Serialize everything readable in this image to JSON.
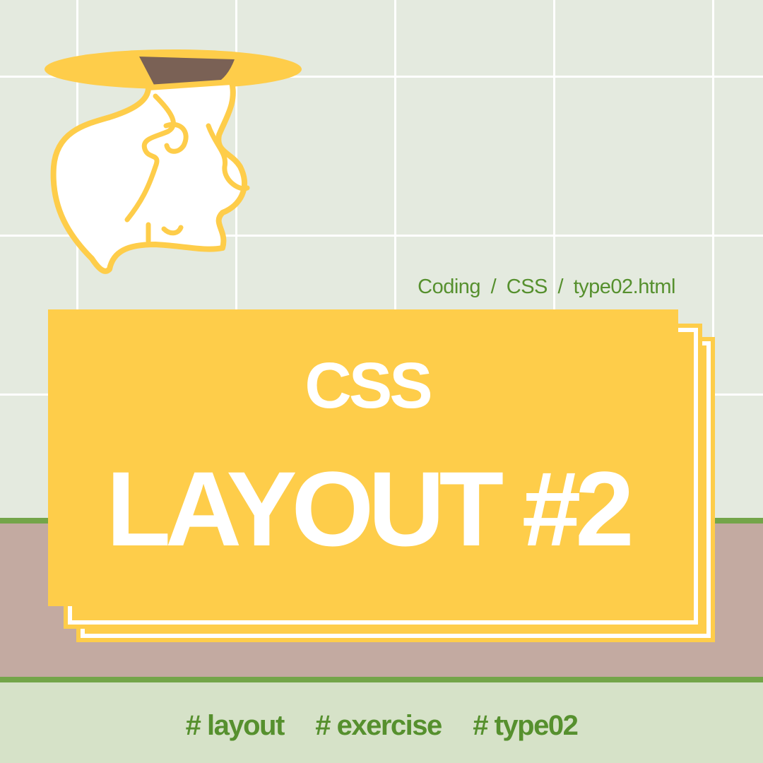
{
  "breadcrumb": {
    "part1": "Coding",
    "part2": "CSS",
    "part3": "type02.html",
    "separator": "/"
  },
  "card": {
    "title_small": "CSS",
    "title_big": "LAYOUT #2"
  },
  "tags": [
    "# layout",
    "# exercise",
    "# type02"
  ],
  "illustration": {
    "icon": "ghost-falling-through-hole-icon"
  },
  "colors": {
    "wall": "#e4eadf",
    "grid": "#ffffff",
    "accent_green": "#56902e",
    "floor_line": "#73a549",
    "floor": "#c3aaa1",
    "footer": "#d6e2c8",
    "card_yellow": "#fecd4a",
    "hole_brown": "#7a6155"
  }
}
